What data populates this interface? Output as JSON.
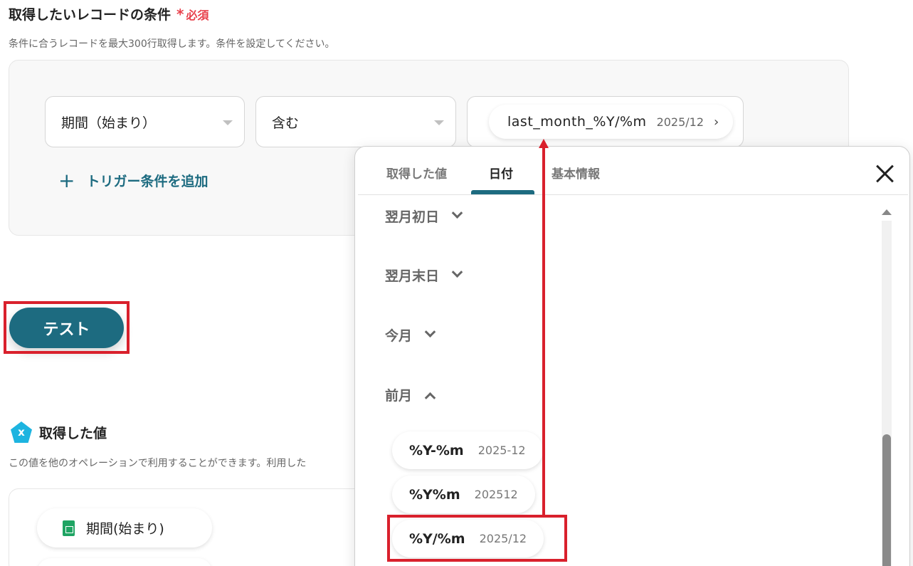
{
  "section": {
    "title": "取得したいレコードの条件",
    "required_label": "必須",
    "description": "条件に合うレコードを最大300行取得します。条件を設定してください。"
  },
  "condition": {
    "field_value": "期間（始まり）",
    "operator_value": "含む",
    "value_chip_key": "last_month_%Y/%m",
    "value_chip_sample": "2025/12",
    "add_trigger_label": "トリガー条件を追加"
  },
  "test_button_label": "テスト",
  "retrieved": {
    "title": "取得した値",
    "icon_letter": "x",
    "description": "この値を他のオペレーションで利用することができます。利用した",
    "chip_label": "期間(始まり)"
  },
  "popup": {
    "tabs": [
      "取得した値",
      "日付",
      "基本情報"
    ],
    "active_tab": "日付",
    "groups": [
      {
        "label": "翌月初日",
        "expanded": false
      },
      {
        "label": "翌月末日",
        "expanded": false
      },
      {
        "label": "今月",
        "expanded": false
      },
      {
        "label": "前月",
        "expanded": true
      }
    ],
    "options": [
      {
        "key": "%Y-%m",
        "sample": "2025-12"
      },
      {
        "key": "%Y%m",
        "sample": "202512"
      },
      {
        "key": "%Y/%m",
        "sample": "2025/12"
      }
    ]
  },
  "colors": {
    "accent": "#1d6b80",
    "required": "#e8414c",
    "highlight": "#d9202c",
    "sheet_icon": "#1fa463",
    "retrieved_icon": "#1db4e0"
  }
}
